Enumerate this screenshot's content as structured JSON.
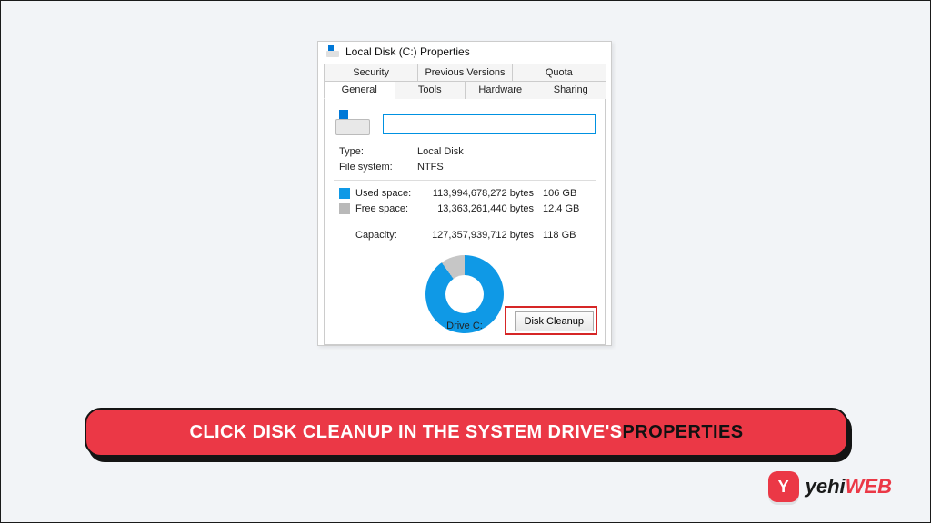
{
  "dialog": {
    "title": "Local Disk (C:) Properties",
    "tabs_row1": [
      "Security",
      "Previous Versions",
      "Quota"
    ],
    "tabs_row2": [
      "General",
      "Tools",
      "Hardware",
      "Sharing"
    ],
    "active_tab": "General",
    "label_value": "",
    "type_label": "Type:",
    "type_value": "Local Disk",
    "fs_label": "File system:",
    "fs_value": "NTFS",
    "used_label": "Used space:",
    "used_bytes": "113,994,678,272 bytes",
    "used_hr": "106 GB",
    "free_label": "Free space:",
    "free_bytes": "13,363,261,440 bytes",
    "free_hr": "12.4 GB",
    "capacity_label": "Capacity:",
    "capacity_bytes": "127,357,939,712 bytes",
    "capacity_hr": "118 GB",
    "drive_label": "Drive C:",
    "cleanup_label": "Disk Cleanup"
  },
  "banner": {
    "text_main": "CLICK DISK CLEANUP IN THE SYSTEM DRIVE'S ",
    "text_accent": "PROPERTIES"
  },
  "brand": {
    "badge_letter": "Y",
    "name_a": "yehi",
    "name_b": "WEB"
  },
  "chart_data": {
    "type": "pie",
    "title": "Drive C:",
    "series": [
      {
        "name": "Used space",
        "value": 106,
        "unit": "GB",
        "color": "#0f99e6"
      },
      {
        "name": "Free space",
        "value": 12.4,
        "unit": "GB",
        "color": "#c6c6c6"
      }
    ],
    "total": {
      "label": "Capacity",
      "value": 118,
      "unit": "GB"
    }
  }
}
